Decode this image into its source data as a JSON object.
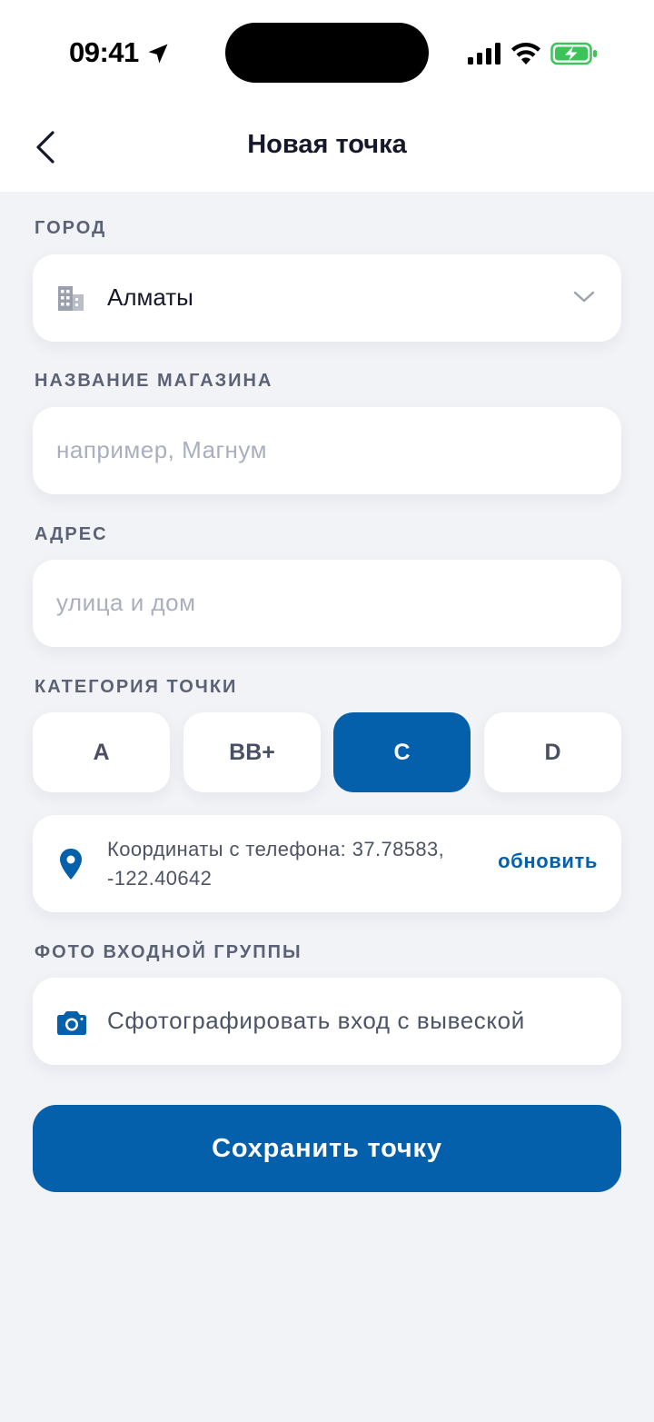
{
  "status_bar": {
    "time": "09:41",
    "icons": [
      "location-arrow-icon",
      "signal-bars-icon",
      "wifi-icon",
      "battery-charging-icon"
    ]
  },
  "header": {
    "title": "Новая точка",
    "back_icon": "chevron-left-icon"
  },
  "form": {
    "city": {
      "label": "ГОРОД",
      "value": "Алматы",
      "icon": "building-icon",
      "dropdown_icon": "chevron-down-icon"
    },
    "store_name": {
      "label": "НАЗВАНИЕ МАГАЗИНА",
      "value": "",
      "placeholder": "например, Магнум"
    },
    "address": {
      "label": "АДРЕС",
      "value": "",
      "placeholder": "улица и дом"
    },
    "category": {
      "label": "КАТЕГОРИЯ ТОЧКИ",
      "options": [
        "A",
        "BB+",
        "C",
        "D"
      ],
      "selected": "C"
    },
    "coordinates": {
      "text": "Координаты с телефона: 37.78583, -122.40642",
      "refresh_label": "обновить",
      "icon": "map-pin-icon"
    },
    "photo": {
      "label": "ФОТО ВХОДНОЙ ГРУППЫ",
      "button_label": "Сфотографировать вход с вывеской",
      "icon": "camera-icon"
    },
    "save_label": "Сохранить точку"
  },
  "colors": {
    "accent": "#0560ab",
    "background": "#f1f3f7",
    "card": "#ffffff",
    "label": "#5b6274",
    "placeholder": "#a9afbd",
    "battery_green": "#3ac45a"
  }
}
